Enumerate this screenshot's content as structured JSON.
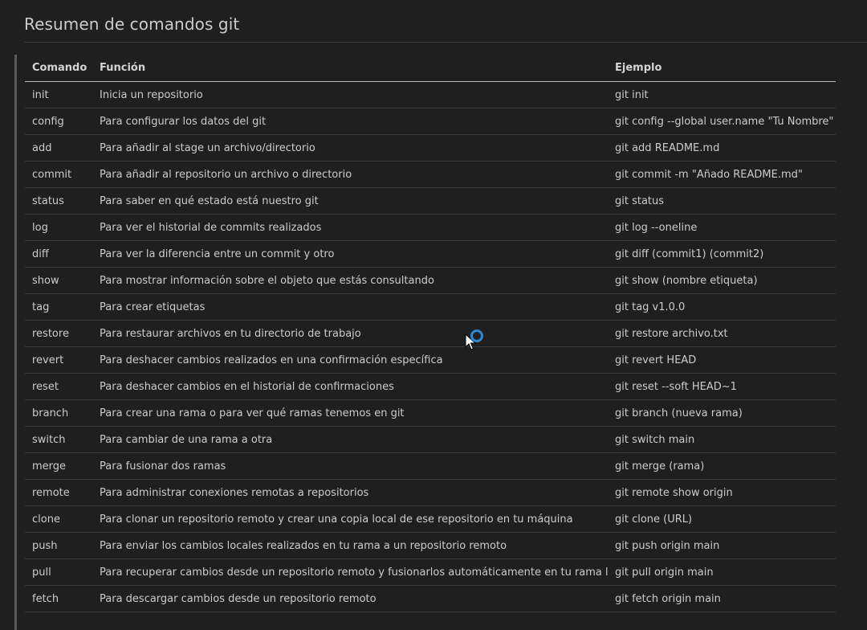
{
  "heading": "Resumen de comandos git",
  "table": {
    "headers": [
      "Comando",
      "Función",
      "Ejemplo"
    ],
    "rows": [
      [
        "init",
        "Inicia un repositorio",
        "git init"
      ],
      [
        "config",
        "Para configurar los datos del git",
        "git config --global user.name \"Tu Nombre\""
      ],
      [
        "add",
        "Para añadir al stage un archivo/directorio",
        "git add README.md"
      ],
      [
        "commit",
        "Para añadir al repositorio un archivo o directorio",
        "git commit -m \"Añado README.md\""
      ],
      [
        "status",
        "Para saber en qué estado está nuestro git",
        "git status"
      ],
      [
        "log",
        "Para ver el historial de commits realizados",
        "git log --oneline"
      ],
      [
        "diff",
        "Para ver la diferencia entre un commit y otro",
        "git diff (commit1) (commit2)"
      ],
      [
        "show",
        "Para mostrar información sobre el objeto que estás consultando",
        "git show (nombre etiqueta)"
      ],
      [
        "tag",
        "Para crear etiquetas",
        "git tag v1.0.0"
      ],
      [
        "restore",
        "Para restaurar archivos en tu directorio de trabajo",
        "git restore archivo.txt"
      ],
      [
        "revert",
        "Para deshacer cambios realizados en una confirmación específica",
        "git revert HEAD"
      ],
      [
        "reset",
        "Para deshacer cambios en el historial de confirmaciones",
        "git reset --soft HEAD~1"
      ],
      [
        "branch",
        "Para crear una rama o para ver qué ramas tenemos en git",
        "git branch (nueva rama)"
      ],
      [
        "switch",
        "Para cambiar de una rama a otra",
        "git switch main"
      ],
      [
        "merge",
        "Para fusionar dos ramas",
        "git merge (rama)"
      ],
      [
        "remote",
        "Para administrar conexiones remotas a repositorios",
        "git remote show origin"
      ],
      [
        "clone",
        "Para clonar un repositorio remoto y crear una copia local de ese repositorio en tu máquina",
        "git clone (URL)"
      ],
      [
        "push",
        "Para enviar los cambios locales realizados en tu rama a un repositorio remoto",
        "git push origin main"
      ],
      [
        "pull",
        "Para recuperar cambios desde un repositorio remoto y fusionarlos automáticamente en tu rama local",
        "git pull origin main"
      ],
      [
        "fetch",
        "Para descargar cambios desde un repositorio remoto",
        "git fetch origin main"
      ]
    ]
  },
  "cursor": {
    "icon": "busy-pointer-icon",
    "ring_color": "#2b8ad6"
  },
  "colors": {
    "background": "#1f1f1f",
    "text": "#cccccc",
    "divider": "#3a3a3a"
  }
}
